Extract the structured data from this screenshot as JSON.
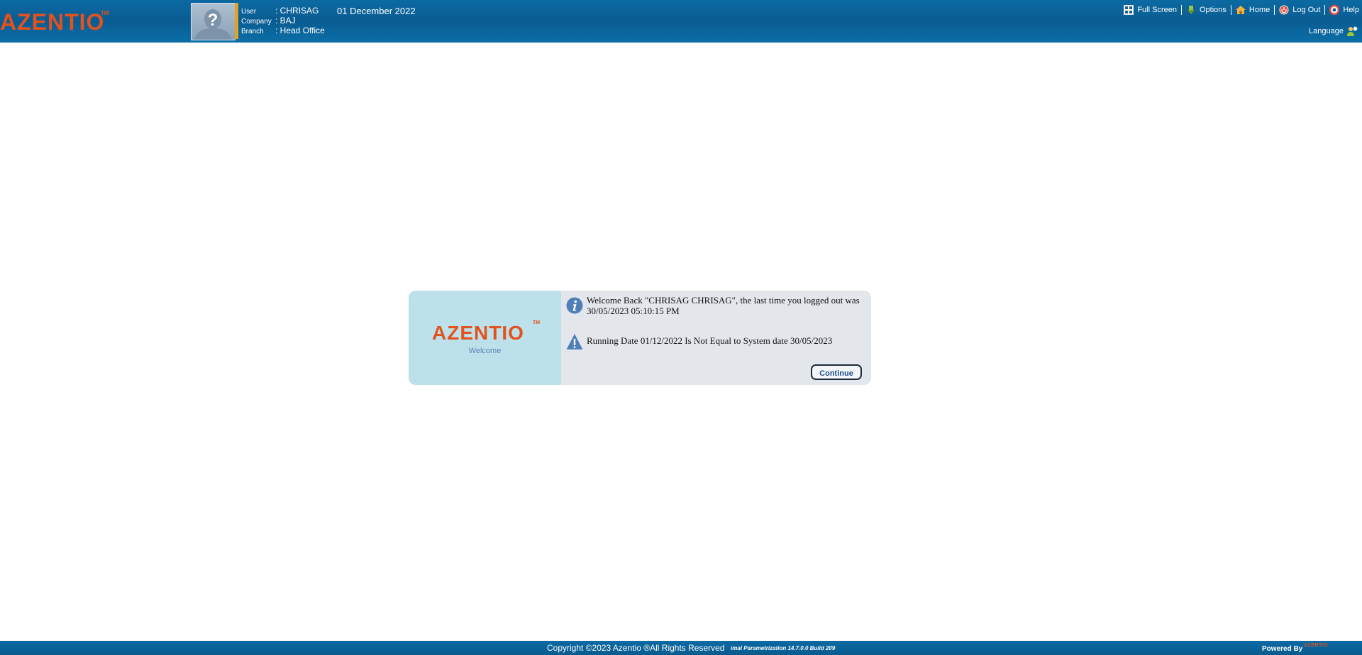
{
  "header": {
    "logo": "AZENTIO",
    "logo_tm": "TM",
    "user_label": "User",
    "user_value": ": CHRISAG",
    "company_label": "Company",
    "company_value": ": BAJ",
    "branch_label": "Branch",
    "branch_value": ": Head Office",
    "date": "01 December 2022",
    "links": {
      "full_screen": "Full Screen",
      "options": "Options",
      "home": "Home",
      "log_out": "Log Out",
      "help": "Help"
    },
    "language": "Language"
  },
  "dialog": {
    "logo": "AZENTIO",
    "logo_tm": "TM",
    "welcome": "Welcome",
    "message_1": "Welcome Back \"CHRISAG CHRISAG\", the last time you logged out was 30/05/2023 05:10:15 PM",
    "message_2": "Running Date 01/12/2022 Is Not Equal to System date 30/05/2023",
    "continue_label": "Continue"
  },
  "footer": {
    "copyright": "Copyright ©2023 Azentio ®All Rights Reserved",
    "build": "imal Parametrization 14.7.0.0 Build 209",
    "powered_by": "Powered By",
    "powered_logo": "AZENTIO"
  },
  "colors": {
    "header_bg": "#0a5c92",
    "brand_orange": "#e2521e",
    "dialog_left_bg": "#bde1ea",
    "dialog_bg": "#e3e7ec",
    "accent_bar": "#e8a020"
  },
  "icons": {
    "full_screen": "full-screen-icon",
    "options": "options-icon",
    "home": "home-icon",
    "log_out": "log-out-icon",
    "help": "help-icon",
    "language": "language-icon",
    "info": "info-icon",
    "warning": "warning-icon"
  }
}
